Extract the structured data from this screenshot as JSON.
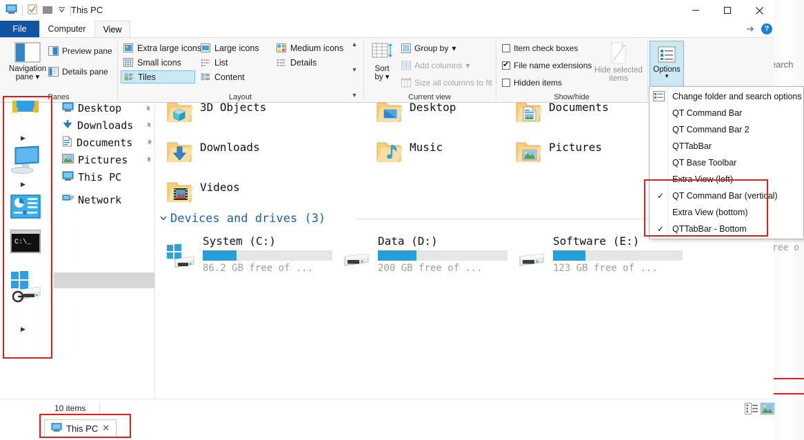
{
  "window": {
    "title": "This PC",
    "quick_access": [
      "this-pc-icon",
      "properties-icon",
      "new-folder-icon",
      "customize-chevron"
    ],
    "controls": {
      "minimize": "—",
      "maximize": "☐",
      "close": "✕",
      "help": "?"
    }
  },
  "ribbon": {
    "tabs": [
      {
        "label": "File",
        "active": false,
        "style": "file"
      },
      {
        "label": "Computer",
        "active": false,
        "style": "normal"
      },
      {
        "label": "View",
        "active": true,
        "style": "normal"
      }
    ],
    "groups": [
      {
        "name": "Panes"
      },
      {
        "name": "Layout"
      },
      {
        "name": "Current view"
      },
      {
        "name": "Show/hide"
      }
    ],
    "panes": {
      "navigation_pane": "Navigation\npane",
      "navigation_pane_line1": "Navigation",
      "navigation_pane_line2": "pane",
      "preview_pane": "Preview pane",
      "details_pane": "Details pane"
    },
    "layout": {
      "items": [
        {
          "label": "Extra large icons",
          "selected": false
        },
        {
          "label": "Large icons",
          "selected": false
        },
        {
          "label": "Medium icons",
          "selected": false
        },
        {
          "label": "Small icons",
          "selected": false
        },
        {
          "label": "List",
          "selected": false
        },
        {
          "label": "Details",
          "selected": false
        },
        {
          "label": "Tiles",
          "selected": true
        },
        {
          "label": "Content",
          "selected": false
        }
      ]
    },
    "current_view": {
      "sort_by_line1": "Sort",
      "sort_by_line2": "by",
      "group_by": "Group by",
      "add_columns": "Add columns",
      "size_all_columns": "Size all columns to fit"
    },
    "show_hide": {
      "item_check_boxes": {
        "label": "Item check boxes",
        "checked": false
      },
      "file_name_extensions": {
        "label": "File name extensions",
        "checked": true
      },
      "hidden_items": {
        "label": "Hidden items",
        "checked": false
      },
      "hide_selected_line1": "Hide selected",
      "hide_selected_line2": "items"
    },
    "options": {
      "label": "Options"
    }
  },
  "options_menu": {
    "items": [
      {
        "label": "Change folder and search options",
        "checked": false,
        "has_icon": true,
        "accel": "o"
      },
      {
        "label": "QT Command Bar",
        "checked": false,
        "has_icon": false
      },
      {
        "label": "QT Command Bar 2",
        "checked": false,
        "has_icon": false
      },
      {
        "label": "QTTabBar",
        "checked": false,
        "has_icon": false
      },
      {
        "label": "QT Base Toolbar",
        "checked": false,
        "has_icon": false
      },
      {
        "label": "Extra View (left)",
        "checked": false,
        "has_icon": false
      },
      {
        "label": "QT Command Bar (vertical)",
        "checked": true,
        "has_icon": false
      },
      {
        "label": "Extra View (bottom)",
        "checked": false,
        "has_icon": false
      },
      {
        "label": "QTTabBar - Bottom",
        "checked": true,
        "has_icon": false
      }
    ]
  },
  "nav_pane": {
    "command_bar_icons": [
      "folder-toolbar-icon",
      "computer-icon",
      "control-panel-icon",
      "command-prompt-icon",
      "windows-drive-icon"
    ],
    "items": [
      {
        "label": "Desktop",
        "icon": "desktop-icon",
        "pinned": true,
        "selected": false
      },
      {
        "label": "Downloads",
        "icon": "downloads-icon",
        "pinned": true,
        "selected": false
      },
      {
        "label": "Documents",
        "icon": "documents-icon",
        "pinned": true,
        "selected": false
      },
      {
        "label": "Pictures",
        "icon": "pictures-icon",
        "pinned": true,
        "selected": false
      },
      {
        "label": "This PC",
        "icon": "this-pc-icon",
        "pinned": false,
        "selected": true
      },
      {
        "label": "Network",
        "icon": "network-icon",
        "pinned": false,
        "selected": false
      }
    ]
  },
  "content": {
    "folders": [
      {
        "label": "3D Objects",
        "icon": "3d-objects-folder-icon"
      },
      {
        "label": "Desktop",
        "icon": "desktop-folder-icon"
      },
      {
        "label": "Documents",
        "icon": "documents-folder-icon"
      },
      {
        "label": "Downloads",
        "icon": "downloads-folder-icon"
      },
      {
        "label": "Music",
        "icon": "music-folder-icon"
      },
      {
        "label": "Pictures",
        "icon": "pictures-folder-icon"
      },
      {
        "label": "Videos",
        "icon": "videos-folder-icon"
      }
    ],
    "devices_header": "Devices and drives (3)",
    "drives": [
      {
        "name": "System (C:)",
        "free_text": "86.2 GB free of ...",
        "used_percent": 26,
        "icon": "windows-drive-icon"
      },
      {
        "name": "Data (D:)",
        "free_text": "200 GB free of ...",
        "used_percent": 30,
        "icon": "drive-icon"
      },
      {
        "name": "Software (E:)",
        "free_text": "123 GB free of ...",
        "used_percent": 25,
        "icon": "drive-icon"
      }
    ]
  },
  "status_bar": {
    "item_count": "10 items",
    "view_buttons": [
      "details-view-icon",
      "large-icons-view-icon"
    ]
  },
  "tab_bar": {
    "tabs": [
      {
        "label": "This PC",
        "close": "✕",
        "icon": "this-pc-icon"
      }
    ]
  },
  "background_window": {
    "search_text": "earch",
    "free_text": "ree o"
  },
  "colors": {
    "accent_blue": "#26a0da",
    "file_tab_blue": "#12559e",
    "selection_blue": "#cce8f4",
    "annotation_red": "#e21b1b",
    "header_link_blue": "#1c5fa8"
  }
}
